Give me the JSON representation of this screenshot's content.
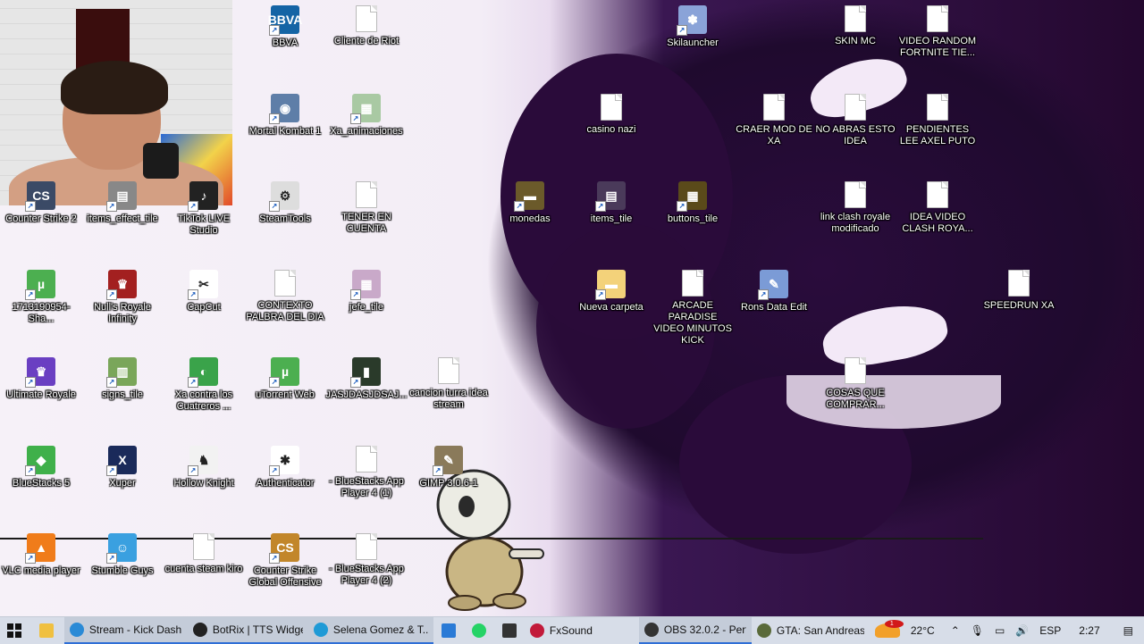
{
  "desktop": {
    "icons": [
      {
        "label": "BBVA",
        "kind": "app",
        "color": "#1464a5",
        "glyph": "BBVA"
      },
      {
        "label": "Cliente de Riot",
        "kind": "doc"
      },
      {
        "label": "Skilauncher",
        "kind": "app",
        "color": "#8aa3d8",
        "glyph": "✽"
      },
      {
        "label": "SKIN MC",
        "kind": "doc"
      },
      {
        "label": "VIDEO RANDOM FORTNITE TIE...",
        "kind": "doc"
      },
      {
        "label": "Mortal Kombat 1",
        "kind": "app",
        "color": "#5e7ea8",
        "glyph": "◉"
      },
      {
        "label": "Xa_animaciones",
        "kind": "app",
        "color": "#a9c9a3",
        "glyph": "▦"
      },
      {
        "label": "casino nazi",
        "kind": "doc"
      },
      {
        "label": "CRAER MOD DE XA",
        "kind": "doc"
      },
      {
        "label": "NO ABRAS ESTO IDEA",
        "kind": "doc"
      },
      {
        "label": "PENDIENTES LEE AXEL PUTO",
        "kind": "doc"
      },
      {
        "label": "Counter Strike 2",
        "kind": "app",
        "color": "#3b4a66",
        "glyph": "CS"
      },
      {
        "label": "items_effect_tile",
        "kind": "app",
        "color": "#888888",
        "glyph": "▤"
      },
      {
        "label": "TikTok LIVE Studio",
        "kind": "app",
        "color": "#222222",
        "glyph": "♪"
      },
      {
        "label": "SteamTools",
        "kind": "app",
        "color": "#dddddd",
        "glyph": "⚙"
      },
      {
        "label": "TENER EN CUENTA",
        "kind": "doc"
      },
      {
        "label": "monedas",
        "kind": "app",
        "color": "#6b5a2a",
        "glyph": "▬"
      },
      {
        "label": "items_tile",
        "kind": "app",
        "color": "#4a3a5a",
        "glyph": "▤"
      },
      {
        "label": "buttons_tile",
        "kind": "app",
        "color": "#5a4a1a",
        "glyph": "▦"
      },
      {
        "label": "link clash royale modificado",
        "kind": "doc"
      },
      {
        "label": "IDEA VIDEO CLASH ROYA...",
        "kind": "doc"
      },
      {
        "label": "1713190954-Sha...",
        "kind": "app",
        "color": "#4caf50",
        "glyph": "µ"
      },
      {
        "label": "Null's Royale Infinity",
        "kind": "app",
        "color": "#a32020",
        "glyph": "♛"
      },
      {
        "label": "CapCut",
        "kind": "app",
        "color": "#ffffff",
        "glyph": "✂"
      },
      {
        "label": "CONTEXTO PALBRA DEL DIA",
        "kind": "doc"
      },
      {
        "label": "jefe_tile",
        "kind": "app",
        "color": "#c9a9c9",
        "glyph": "▦"
      },
      {
        "label": "Nueva carpeta",
        "kind": "app",
        "color": "#f3d27a",
        "glyph": "▬"
      },
      {
        "label": "ARCADE PARADISE VIDEO MINUTOS KICK",
        "kind": "doc"
      },
      {
        "label": "Rons Data Edit",
        "kind": "app",
        "color": "#7b9bd6",
        "glyph": "✎"
      },
      {
        "label": "SPEEDRUN XA",
        "kind": "doc"
      },
      {
        "label": "Ultimate Royale",
        "kind": "app",
        "color": "#6a3fc2",
        "glyph": "♛"
      },
      {
        "label": "signs_tile",
        "kind": "app",
        "color": "#7aa65a",
        "glyph": "▥"
      },
      {
        "label": "Xa contra los Cuatreros ...",
        "kind": "app",
        "color": "#3aa34a",
        "glyph": "◐"
      },
      {
        "label": "uTorrent Web",
        "kind": "app",
        "color": "#4caf50",
        "glyph": "µ"
      },
      {
        "label": "JASJDASJDSAJ...",
        "kind": "app",
        "color": "#2a3a2a",
        "glyph": "▮"
      },
      {
        "label": "cancion turra idea stream",
        "kind": "doc"
      },
      {
        "label": "COSAS QUE COMPRAR...",
        "kind": "doc"
      },
      {
        "label": "BlueStacks 5",
        "kind": "app",
        "color": "#3fb04a",
        "glyph": "◆"
      },
      {
        "label": "Xuper",
        "kind": "app",
        "color": "#1a2a5a",
        "glyph": "X"
      },
      {
        "label": "Hollow Knight",
        "kind": "app",
        "color": "#f2f2f2",
        "glyph": "♞"
      },
      {
        "label": "Authenticator",
        "kind": "app",
        "color": "#ffffff",
        "glyph": "✱"
      },
      {
        "label": "- BlueStacks App Player 4 (1)",
        "kind": "doc"
      },
      {
        "label": "GIMP 3.0.6-1",
        "kind": "app",
        "color": "#8a7a5a",
        "glyph": "✎"
      },
      {
        "label": "VLC media player",
        "kind": "app",
        "color": "#f07c1a",
        "glyph": "▲"
      },
      {
        "label": "Stumble Guys",
        "kind": "app",
        "color": "#3aa0e0",
        "glyph": "☺"
      },
      {
        "label": "cuenta steam kiro",
        "kind": "doc"
      },
      {
        "label": "Counter Strike Global Offensive",
        "kind": "app",
        "color": "#c2862a",
        "glyph": "CS"
      },
      {
        "label": "- BlueStacks App Player 4 (2)",
        "kind": "doc"
      }
    ]
  },
  "taskbar": {
    "apps": [
      {
        "label": "Stream - Kick Dash...",
        "color": "#2a8ad6"
      },
      {
        "label": "BotRix | TTS Widge...",
        "color": "#222222"
      },
      {
        "label": "Selena Gomez & T...",
        "color": "#1f9ad6"
      },
      {
        "label": "FxSound",
        "color": "#c21a3a"
      },
      {
        "label": "OBS 32.0.2 - Perfil: ...",
        "color": "#333333"
      },
      {
        "label": "GTA: San Andreas",
        "color": "#5a6a3a"
      }
    ],
    "tray": {
      "temperature": "22°C",
      "language": "ESP",
      "time": "2:27",
      "weather_badge": "1"
    }
  }
}
